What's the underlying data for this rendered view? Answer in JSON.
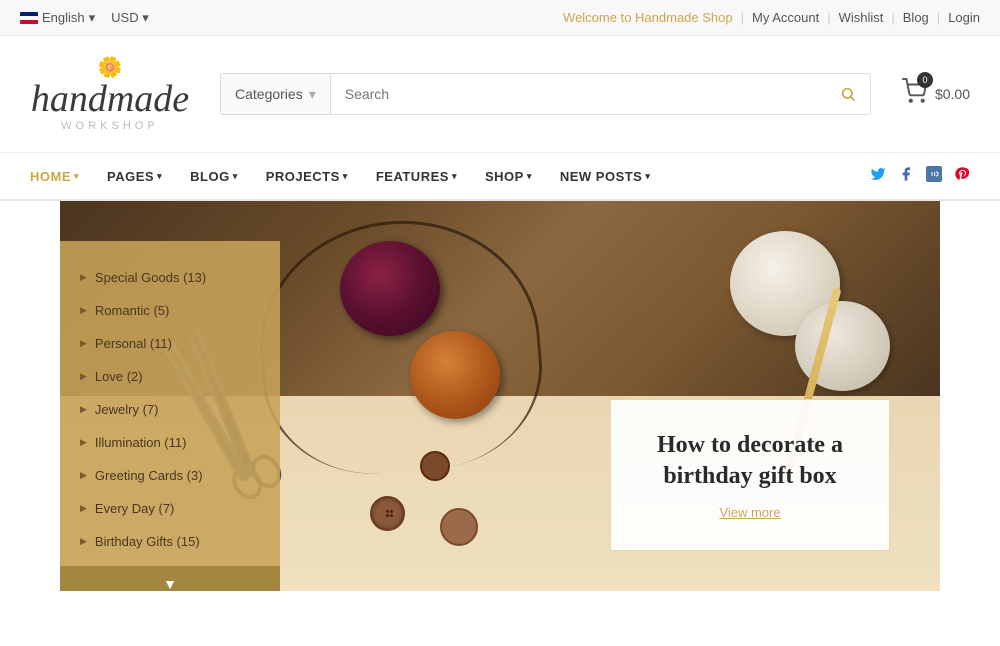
{
  "topbar": {
    "language": "English",
    "currency": "USD",
    "welcome": "Welcome to Handmade Shop",
    "links": [
      "My Account",
      "Wishlist",
      "Blog",
      "Login"
    ]
  },
  "header": {
    "logo_main": "handmade",
    "logo_sub": "workshop",
    "logo_swirl": "~~~",
    "categories_label": "Categories",
    "search_placeholder": "Search",
    "cart_badge": "0",
    "cart_price": "$0.00"
  },
  "nav": {
    "items": [
      {
        "label": "HOME",
        "active": true
      },
      {
        "label": "PAGES",
        "active": false
      },
      {
        "label": "BLOG",
        "active": false
      },
      {
        "label": "PROJECTS",
        "active": false
      },
      {
        "label": "FEATURES",
        "active": false
      },
      {
        "label": "SHOP",
        "active": false
      },
      {
        "label": "NEW POSTS",
        "active": false
      }
    ],
    "socials": [
      "twitter",
      "facebook",
      "vk",
      "pinterest"
    ]
  },
  "sidebar": {
    "items": [
      {
        "label": "Special Goods",
        "count": "(13)"
      },
      {
        "label": "Romantic",
        "count": "(5)"
      },
      {
        "label": "Personal",
        "count": "(11)"
      },
      {
        "label": "Love",
        "count": "(2)"
      },
      {
        "label": "Jewelry",
        "count": "(7)"
      },
      {
        "label": "Illumination",
        "count": "(11)"
      },
      {
        "label": "Greeting Cards",
        "count": "(3)"
      },
      {
        "label": "Every Day",
        "count": "(7)"
      },
      {
        "label": "Birthday Gifts",
        "count": "(15)"
      }
    ],
    "expand_icon": "▼"
  },
  "hero": {
    "title": "How to decorate a birthday gift box",
    "view_more": "View more"
  }
}
